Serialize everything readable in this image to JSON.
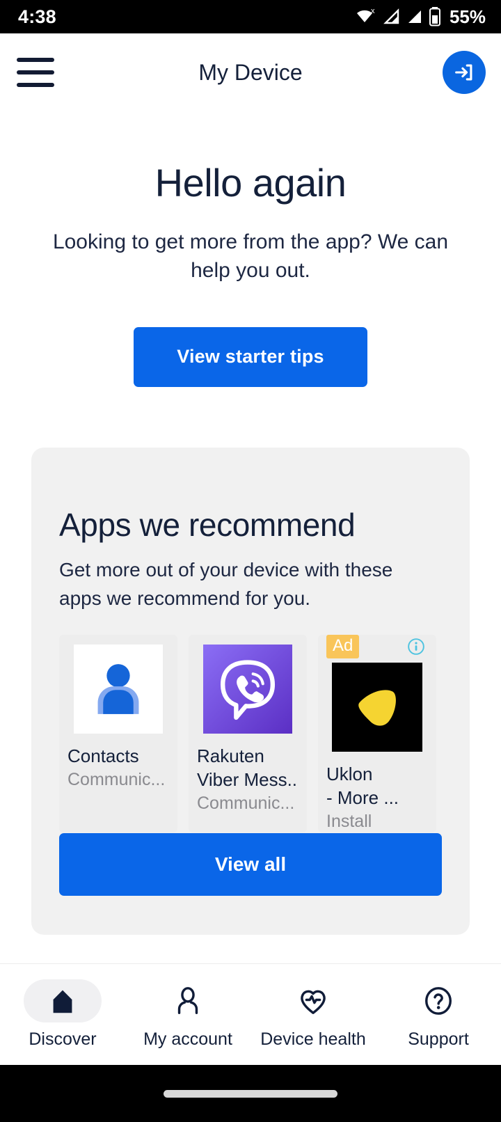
{
  "status_bar": {
    "time": "4:38",
    "battery_percent": "55%",
    "icons": [
      "wifi-no-internet-icon",
      "cellular-signal-1-icon",
      "cellular-signal-2-icon",
      "battery-icon"
    ]
  },
  "app_bar": {
    "menu_icon": "hamburger-menu-icon",
    "title": "My Device",
    "action_icon": "sign-in-icon"
  },
  "hero": {
    "heading": "Hello again",
    "subheading": "Looking to get more from the app? We can help you out.",
    "cta_label": "View starter tips"
  },
  "recommend_card": {
    "heading": "Apps we recommend",
    "description": "Get more out of your device with these apps we recommend for you.",
    "view_all_label": "View all",
    "apps": [
      {
        "name": "Contacts",
        "subtitle": "Communic...",
        "icon": "contacts-person-icon",
        "is_ad": false
      },
      {
        "name": "Rakuten Viber Mess...",
        "name_line1": "Rakuten",
        "name_line2": "Viber Mess...",
        "subtitle": "Communic...",
        "icon": "viber-phone-bubble-icon",
        "is_ad": false
      },
      {
        "name": "Uklon - More ...",
        "name_line1": "Uklon",
        "name_line2": "- More ...",
        "subtitle": "Install",
        "icon": "uklon-yellow-triangle-icon",
        "is_ad": true,
        "ad_badge": "Ad",
        "info_icon": "info-icon"
      }
    ]
  },
  "bottom_nav": {
    "items": [
      {
        "label": "Discover",
        "icon": "home-icon",
        "active": true
      },
      {
        "label": "My account",
        "icon": "person-icon",
        "active": false
      },
      {
        "label": "Device health",
        "icon": "heart-pulse-icon",
        "active": false
      },
      {
        "label": "Support",
        "icon": "question-circle-icon",
        "active": false
      }
    ]
  },
  "colors": {
    "accent_blue": "#0a66e8",
    "dark_navy": "#14203a",
    "card_gray": "#f1f1f1",
    "ad_badge": "#f9c55a",
    "viber_purple": "#7360f2"
  }
}
